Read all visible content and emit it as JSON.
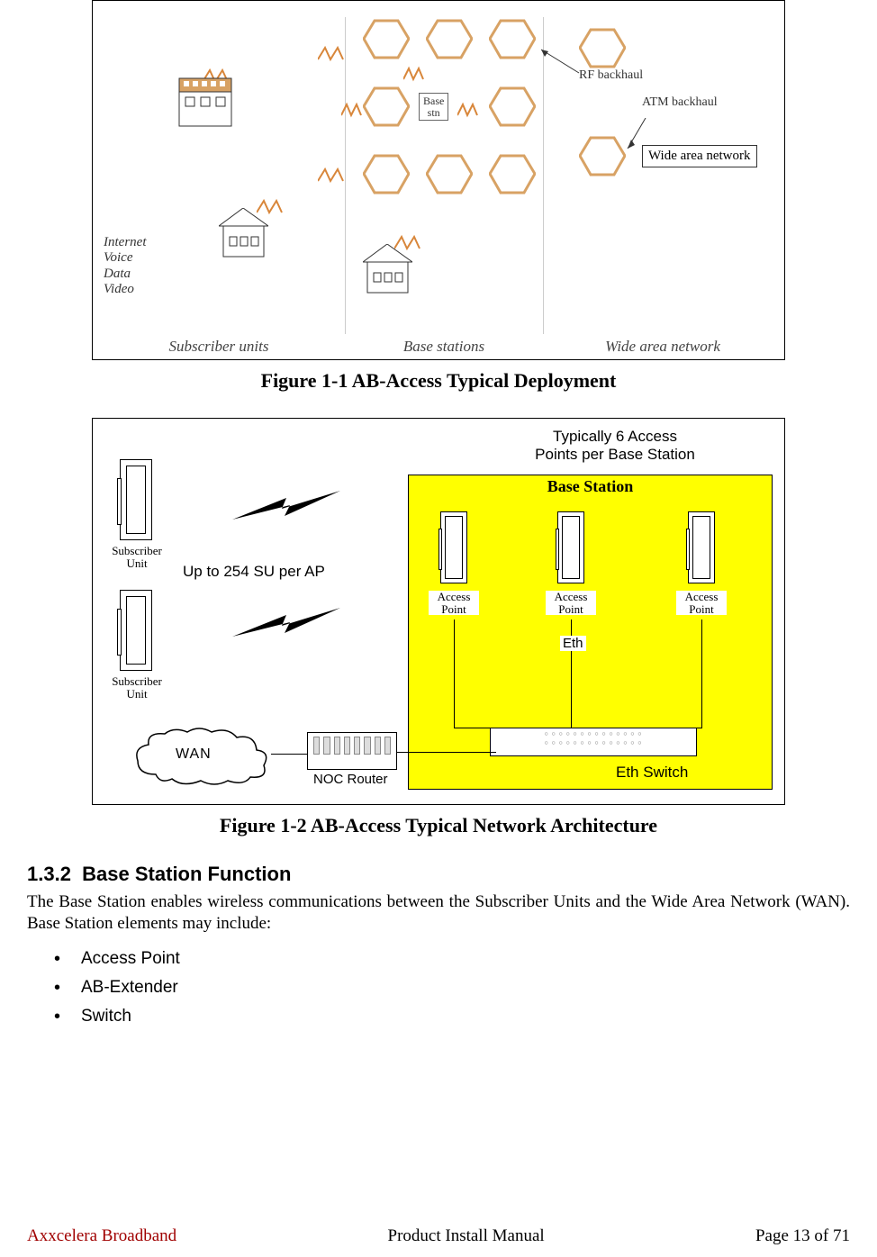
{
  "figure1": {
    "caption": "Figure 1-1 AB-Access Typical Deployment",
    "col_labels": {
      "subscriber": "Subscriber units",
      "base": "Base stations",
      "wan": "Wide area network"
    },
    "rf_backhaul": "RF backhaul",
    "atm_backhaul": "ATM backhaul",
    "wan_box": "Wide area network",
    "base_stn": "Base stn",
    "services": [
      "Internet",
      "Voice",
      "Data",
      "Video"
    ]
  },
  "figure2": {
    "caption": "Figure 1-2 AB-Access Typical Network Architecture",
    "top_note_1": "Typically 6 Access",
    "top_note_2": "Points per Base Station",
    "base_station_title": "Base Station",
    "su_label": "Subscriber Unit",
    "su_per_ap": "Up to 254 SU per AP",
    "ap_label": "Access Point",
    "eth": "Eth",
    "eth_switch": "Eth Switch",
    "noc_router": "NOC Router",
    "wan": "WAN"
  },
  "section": {
    "number": "1.3.2",
    "title": "Base Station Function",
    "body": "The Base Station enables wireless communications between the Subscriber Units and the Wide Area Network (WAN).  Base Station elements may include:",
    "bullets": [
      "Access Point",
      "AB-Extender",
      "Switch"
    ]
  },
  "footer": {
    "left": "Axxcelera Broadband",
    "center": "Product Install Manual",
    "right": "Page 13 of 71"
  }
}
